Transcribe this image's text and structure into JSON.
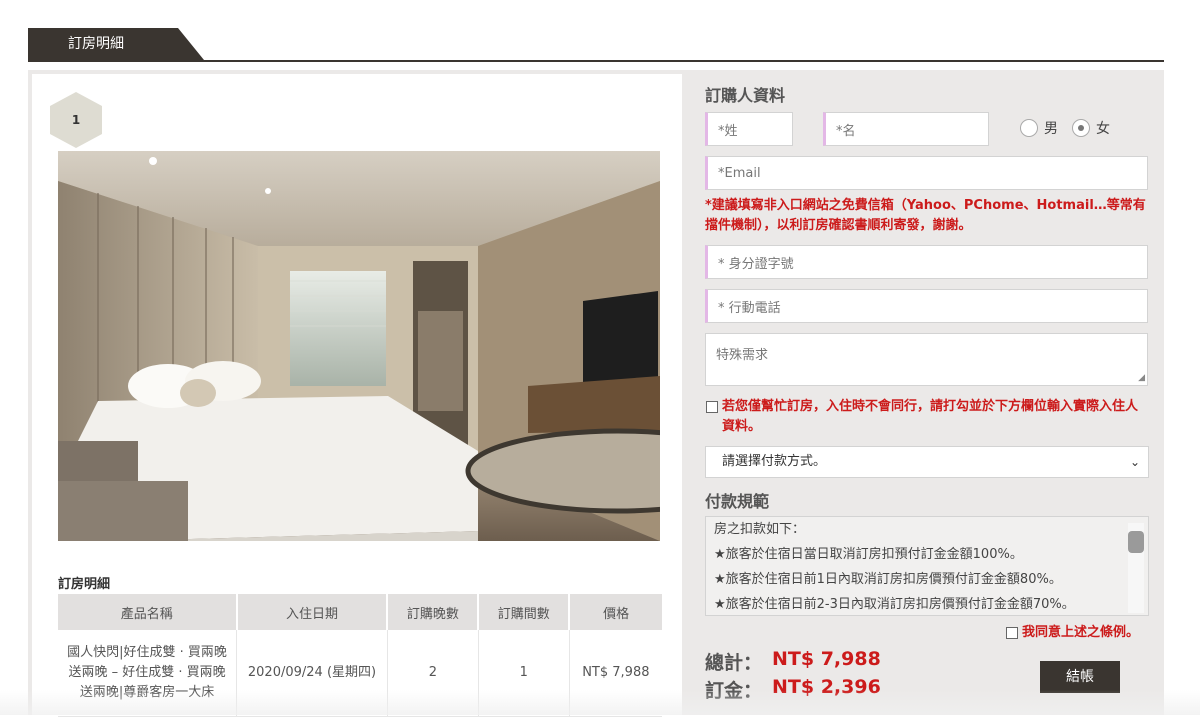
{
  "header": {
    "tab_label": "訂房明細"
  },
  "room": {
    "index": "1",
    "details_title": "訂房明細",
    "columns": [
      "產品名稱",
      "入住日期",
      "訂購晚數",
      "訂購間數",
      "價格"
    ],
    "rows": [
      [
        "國人快閃|好住成雙 · 買兩晚送兩晚 – 好住成雙 · 買兩晚送兩晚|尊爵客房一大床",
        "2020/09/24 (星期四)",
        "2",
        "1",
        "NT$ 7,988"
      ]
    ]
  },
  "form": {
    "title": "訂購人資料",
    "last_name_placeholder": "*姓",
    "first_name_placeholder": "*名",
    "gender_male": "男",
    "gender_female": "女",
    "selected_gender": "female",
    "email_placeholder": "*Email",
    "email_note": "*建議填寫非入口網站之免費信箱（Yahoo、PChome、Hotmail…等常有擋件機制），以利訂房確認書順利寄發，謝謝。",
    "id_placeholder": "* 身分證字號",
    "phone_placeholder": "* 行動電話",
    "special_request_placeholder": "特殊需求",
    "proxy_booking_note": "若您僅幫忙訂房，入住時不會同行，請打勾並於下方欄位輸入實際入住人資料。",
    "payment_select": "請選擇付款方式。"
  },
  "rules": {
    "title": "付款規範",
    "lines": [
      "房之扣款如下：",
      "★旅客於住宿日當日取消訂房扣預付訂金金額100%。",
      "★旅客於住宿日前1日內取消訂房扣房價預付訂金金額80%。",
      "★旅客於住宿日前2-3日內取消訂房扣房價預付訂金金額70%。"
    ],
    "agree_label": "我同意上述之條例。"
  },
  "summary": {
    "total_label": "總計：",
    "total_value": "NT$ 7,988",
    "deposit_label": "訂金：",
    "deposit_value": "NT$ 2,396",
    "checkout_label": "結帳"
  },
  "colors": {
    "accent_red": "#cc1b1b",
    "dark_brown": "#3a3530",
    "required_marker": "#e3b7e6"
  }
}
